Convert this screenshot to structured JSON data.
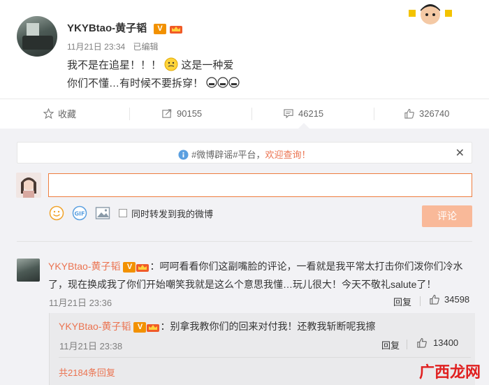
{
  "post": {
    "author": "YKYBtao-黄子韬",
    "vip_badge": "V",
    "timestamp": "11月21日 23:34",
    "edited": "已编辑",
    "line1_a": "我不是在追星！！！",
    "line1_b": "这是一种爱",
    "line2": "你们不懂…有时候不要拆穿！"
  },
  "actions": {
    "favorite": "收藏",
    "repost_count": "90155",
    "comment_count": "46215",
    "like_count": "326740"
  },
  "notice": {
    "text_a": "#微博辟谣#平台，",
    "text_b": "欢迎查询！"
  },
  "composer": {
    "input_value": "",
    "repost_label": "同时转发到我的微博",
    "submit_label": "评论"
  },
  "comment": {
    "author": "YKYBtao-黄子韬",
    "text": "：呵呵看看你们这副嘴脸的评论，一看就是我平常太打击你们泼你们冷水了，现在换成我了你们开始嘲笑我就是这么个意思我懂…玩儿很大！今天不敬礼salute了！",
    "timestamp": "11月21日 23:36",
    "reply_label": "回复",
    "like_count": "34598"
  },
  "reply": {
    "author": "YKYBtao-黄子韬",
    "text": "：别拿我教你们的回来对付我！还教我斩断呢我擦",
    "timestamp": "11月21日 23:38",
    "reply_label": "回复",
    "like_count": "13400",
    "more_replies": "共2184条回复"
  },
  "watermark": "广西龙网",
  "colors": {
    "accent": "#eb7350",
    "badge": "#f29100",
    "input_border": "#ee7d3e",
    "button": "#f9b999"
  }
}
